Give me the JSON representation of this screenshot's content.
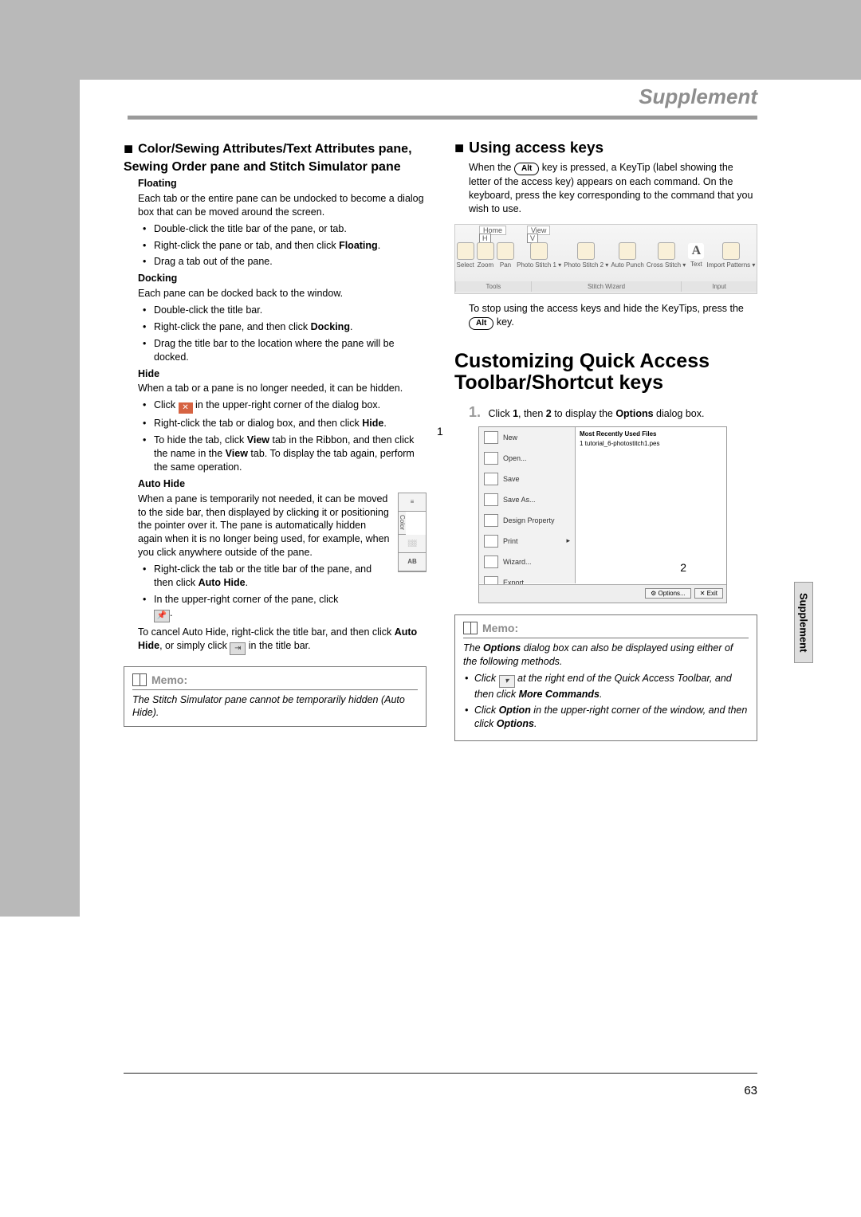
{
  "header_title": "Supplement",
  "side_tab": "Supplement",
  "page_number": "63",
  "left": {
    "sec_title": "Color/Sewing Attributes/Text Attributes pane, Sewing Order pane and Stitch Simulator pane",
    "floating": {
      "label": "Floating",
      "para": "Each tab or the entire pane can be undocked to become a dialog box that can be moved around the screen.",
      "b1": "Double-click the title bar of the pane, or tab.",
      "b2_a": "Right-click the pane or tab, and then click ",
      "b2_b": "Floating",
      "b3": "Drag a tab out of the pane."
    },
    "docking": {
      "label": "Docking",
      "para": "Each pane can be docked back to the window.",
      "b1": "Double-click the title bar.",
      "b2_a": "Right-click the pane, and then click ",
      "b2_b": "Docking",
      "b3": "Drag the title bar to the location where the pane will be docked."
    },
    "hide": {
      "label": "Hide",
      "para": "When a tab or a pane is no longer needed, it can be hidden.",
      "b1_a": "Click ",
      "b1_b": " in the upper-right corner of the dialog box.",
      "b2_a": "Right-click the tab or dialog box, and then click ",
      "b2_b": "Hide",
      "b3_a": "To hide the tab, click ",
      "b3_b": "View",
      "b3_c": " tab in the Ribbon, and then click the name in the ",
      "b3_d": "View",
      "b3_e": " tab. To display the tab again, perform the same operation."
    },
    "autohide": {
      "label": "Auto Hide",
      "para": "When a pane is temporarily not needed, it can be moved to the side bar, then displayed by clicking it or positioning the pointer over it. The pane is automatically hidden again when it is no longer being used, for example, when you click anywhere outside of the pane.",
      "b1_a": "Right-click the tab or the title bar of the pane, and then click ",
      "b1_b": "Auto Hide",
      "b2": "In the upper-right corner of the pane, click ",
      "cancel_a": "To cancel Auto Hide, right-click the title bar, and then click ",
      "cancel_b": "Auto Hide",
      "cancel_c": ", or simply click ",
      "cancel_d": " in the title bar."
    },
    "memo": {
      "title": "Memo:",
      "body": "The Stitch Simulator pane cannot be temporarily hidden (Auto Hide)."
    },
    "side_thumb": {
      "r1": "≡",
      "r2": "Color",
      "r3": "░░",
      "r4": "AB"
    }
  },
  "right": {
    "access": {
      "title": "Using access keys",
      "p1_a": "When the ",
      "p1_b": " key is pressed, a KeyTip (label showing the letter of the access key) appears on each command. On the keyboard, press the key corresponding to the command that you wish to use.",
      "p2_a": "To stop using the access keys and hide the KeyTips, press the ",
      "p2_b": " key.",
      "alt": "Alt"
    },
    "ribbon": {
      "tab_home": "Home",
      "tab_home_key": "H",
      "tab_view": "View",
      "tab_view_key": "V",
      "grp_tools": "Tools",
      "grp_wizard": "Stitch Wizard",
      "grp_input": "Input",
      "i_select": "Select",
      "i_zoom": "Zoom",
      "i_pan": "Pan",
      "i_ps1": "Photo\nStitch 1 ▾",
      "i_ps2": "Photo\nStitch 2 ▾",
      "i_auto": "Auto\nPunch",
      "i_cross": "Cross\nStitch ▾",
      "i_text": "Text",
      "i_import": "Import\nPatterns ▾"
    },
    "customize": {
      "title": "Customizing Quick Access Toolbar/Shortcut keys",
      "step1_a": "Click ",
      "step1_b": "1",
      "step1_c": ", then ",
      "step1_d": "2",
      "step1_e": " to display the ",
      "step1_f": "Options",
      "step1_g": " dialog box.",
      "n1": "1",
      "n2": "2"
    },
    "menu": {
      "recent": "Most Recently Used Files",
      "recent_item": "1 tutorial_6-photostitch1.pes",
      "new": "New",
      "open": "Open...",
      "save": "Save",
      "saveas": "Save As...",
      "dprop": "Design Property",
      "print": "Print",
      "wizard": "Wizard...",
      "export": "Export...",
      "opt_btn": "⚙ Options...",
      "exit_btn": "✕ Exit"
    },
    "memo": {
      "title": "Memo:",
      "line1_a": "The ",
      "line1_b": "Options",
      "line1_c": " dialog box can also be displayed using either of the following methods.",
      "b1_a": "Click ",
      "b1_b": " at the right end of the Quick Access Toolbar, and then click ",
      "b1_c": "More Commands",
      "b2_a": "Click ",
      "b2_b": "Option",
      "b2_c": " in the upper-right corner of the window, and then click ",
      "b2_d": "Options"
    }
  }
}
